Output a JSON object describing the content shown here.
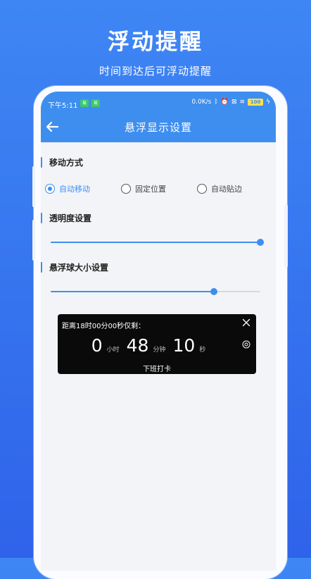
{
  "promo": {
    "title": "浮动提醒",
    "subtitle": "时间到达后可浮动提醒"
  },
  "status_bar": {
    "time": "下午5:11",
    "badge_1": "易",
    "badge_2": "易",
    "network_speed": "0.0K/s",
    "battery_level": "100"
  },
  "app_bar": {
    "title": "悬浮显示设置"
  },
  "sections": {
    "move_mode": {
      "label": "移动方式",
      "options": [
        {
          "label": "自动移动",
          "selected": true
        },
        {
          "label": "固定位置",
          "selected": false
        },
        {
          "label": "自动贴边",
          "selected": false
        }
      ]
    },
    "opacity": {
      "label": "透明度设置",
      "value_percent": 100
    },
    "ball_size": {
      "label": "悬浮球大小设置",
      "value_percent": 78
    }
  },
  "floating_preview": {
    "heading": "距离18时00分00秒仅剩：",
    "hours": "0",
    "hours_unit": "小时",
    "minutes": "48",
    "minutes_unit": "分钟",
    "seconds": "10",
    "seconds_unit": "秒",
    "action_label": "下班打卡"
  },
  "colors": {
    "accent": "#3e8ef0",
    "background_top": "#3f86f4",
    "card_background": "#0a0a0a"
  }
}
